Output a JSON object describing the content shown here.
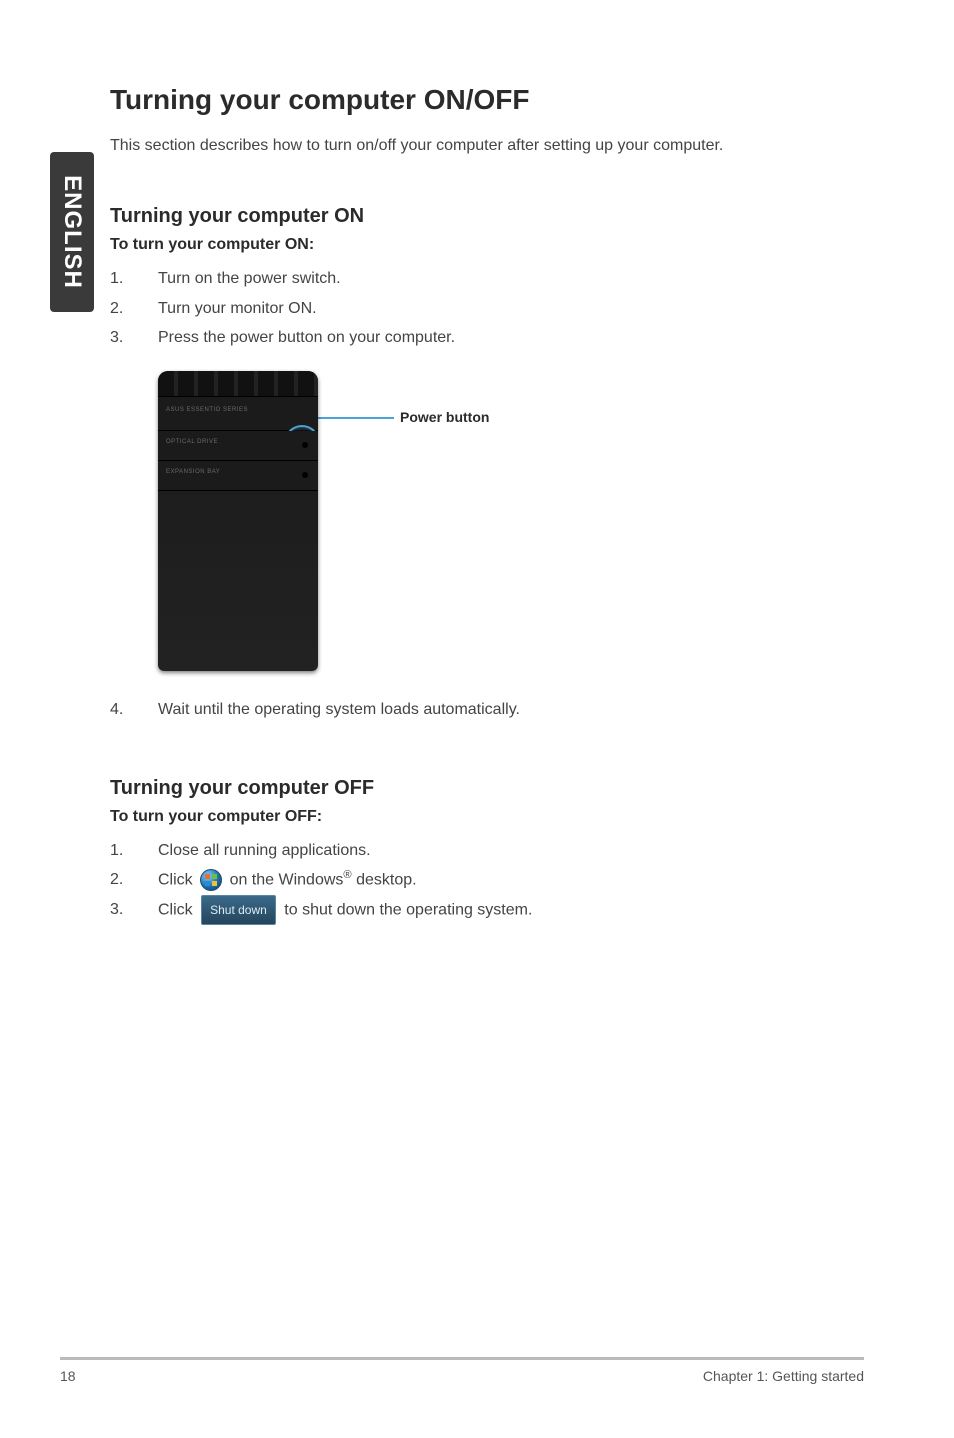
{
  "sidebar": {
    "language": "ENGLISH"
  },
  "title": "Turning your computer ON/OFF",
  "intro": "This section describes how to turn on/off your computer after setting up your computer.",
  "on": {
    "heading": "Turning your computer ON",
    "subheading": "To turn your computer ON:",
    "steps": [
      {
        "n": "1.",
        "t": "Turn on the power switch."
      },
      {
        "n": "2.",
        "t": "Turn your monitor ON."
      },
      {
        "n": "3.",
        "t": "Press the power button on your computer."
      }
    ],
    "callout": "Power button",
    "device_labels": {
      "top": "ASUS ESSENTIO SERIES",
      "optical": "OPTICAL DRIVE",
      "expansion": "EXPANSION BAY"
    },
    "step4": {
      "n": "4.",
      "t": "Wait until the operating system loads automatically."
    }
  },
  "off": {
    "heading": "Turning your computer OFF",
    "subheading": "To turn your computer OFF:",
    "steps": {
      "s1": {
        "n": "1.",
        "t": "Close all running applications."
      },
      "s2": {
        "n": "2.",
        "pre": "Click ",
        "post_a": " on the Windows",
        "post_b": " desktop."
      },
      "s3": {
        "n": "3.",
        "pre": "Click ",
        "btn": "Shut down",
        "post": " to shut down the operating system."
      }
    }
  },
  "footer": {
    "page": "18",
    "chapter": "Chapter 1: Getting started"
  }
}
